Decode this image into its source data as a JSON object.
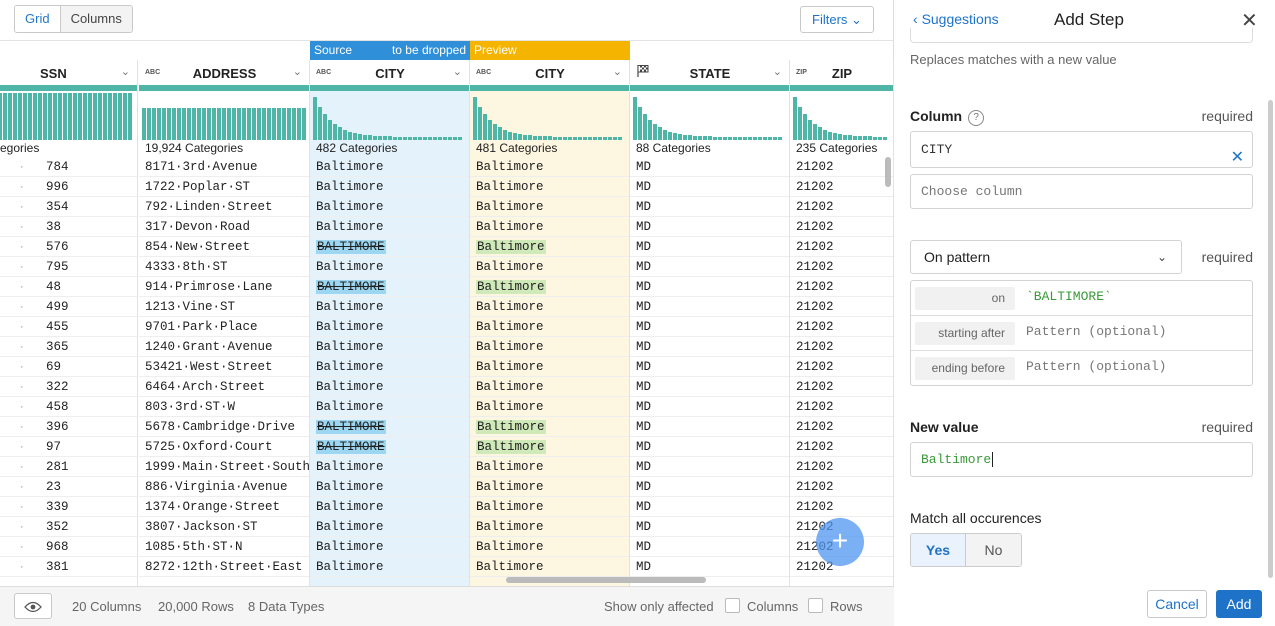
{
  "toolbar": {
    "tabs": [
      "Grid",
      "Columns"
    ],
    "filters_label": "Filters"
  },
  "grid": {
    "row_prefixes": [
      "784",
      "996",
      "354",
      "38",
      "576",
      "795",
      "48",
      "499",
      "455",
      "365",
      "69",
      "322",
      "458",
      "396",
      "97",
      "281",
      "23",
      "339",
      "352",
      "968",
      "381"
    ],
    "columns": [
      {
        "type": "",
        "name": "SSN",
        "categories": "egories",
        "values": []
      },
      {
        "type": "ABC",
        "name": "ADDRESS",
        "categories": "19,924 Categories",
        "values": [
          "8171·3rd·Avenue",
          "1722·Poplar·ST",
          "792·Linden·Street",
          "317·Devon·Road",
          "854·New·Street",
          "4333·8th·ST",
          "914·Primrose·Lane",
          "1213·Vine·ST",
          "9701·Park·Place",
          "1240·Grant·Avenue",
          "53421·West·Street",
          "6464·Arch·Street",
          "803·3rd·ST·W",
          "5678·Cambridge·Drive",
          "5725·Oxford·Court",
          "1999·Main·Street·South",
          "886·Virginia·Avenue",
          "1374·Orange·Street",
          "3807·Jackson·ST",
          "1085·5th·ST·N",
          "8272·12th·Street·East"
        ]
      },
      {
        "type": "ABC",
        "name": "CITY",
        "categories": "482 Categories",
        "tag": "Source",
        "tag_right": "to be dropped",
        "values": [
          "Baltimore",
          "Baltimore",
          "Baltimore",
          "Baltimore",
          "BALTIMORE",
          "Baltimore",
          "BALTIMORE",
          "Baltimore",
          "Baltimore",
          "Baltimore",
          "Baltimore",
          "Baltimore",
          "Baltimore",
          "BALTIMORE",
          "BALTIMORE",
          "Baltimore",
          "Baltimore",
          "Baltimore",
          "Baltimore",
          "Baltimore",
          "Baltimore"
        ]
      },
      {
        "type": "ABC",
        "name": "CITY",
        "categories": "481 Categories",
        "tag": "Preview",
        "values": [
          "Baltimore",
          "Baltimore",
          "Baltimore",
          "Baltimore",
          "Baltimore",
          "Baltimore",
          "Baltimore",
          "Baltimore",
          "Baltimore",
          "Baltimore",
          "Baltimore",
          "Baltimore",
          "Baltimore",
          "Baltimore",
          "Baltimore",
          "Baltimore",
          "Baltimore",
          "Baltimore",
          "Baltimore",
          "Baltimore",
          "Baltimore"
        ]
      },
      {
        "type": "flag",
        "name": "STATE",
        "categories": "88 Categories",
        "values": [
          "MD",
          "MD",
          "MD",
          "MD",
          "MD",
          "MD",
          "MD",
          "MD",
          "MD",
          "MD",
          "MD",
          "MD",
          "MD",
          "MD",
          "MD",
          "MD",
          "MD",
          "MD",
          "MD",
          "MD",
          "MD"
        ]
      },
      {
        "type": "ZIP",
        "name": "ZIP",
        "categories": "235 Categories",
        "values": [
          "21202",
          "21202",
          "21202",
          "21202",
          "21202",
          "21202",
          "21202",
          "21202",
          "21202",
          "21202",
          "21202",
          "21202",
          "21202",
          "21202",
          "21202",
          "21202",
          "21202",
          "21202",
          "21202",
          "21202",
          "21202"
        ]
      }
    ],
    "changed_rows": [
      4,
      6,
      13,
      14
    ]
  },
  "status": {
    "columns": "20 Columns",
    "rows": "20,000 Rows",
    "types": "8 Data Types",
    "show_only_affected": "Show only affected",
    "cb_columns": "Columns",
    "cb_rows": "Rows"
  },
  "panel": {
    "back": "Suggestions",
    "title": "Add Step",
    "description": "Replaces matches with a new value",
    "column_label": "Column",
    "required": "required",
    "column_value": "CITY",
    "choose_placeholder": "Choose column",
    "mode": "On pattern",
    "pattern_rows": [
      {
        "label": "on",
        "value": "`BALTIMORE`"
      },
      {
        "label": "starting after",
        "value": "Pattern (optional)"
      },
      {
        "label": "ending before",
        "value": "Pattern (optional)"
      }
    ],
    "new_value_label": "New value",
    "new_value": "Baltimore",
    "match_all_label": "Match all occurences",
    "yes": "Yes",
    "no": "No",
    "cancel": "Cancel",
    "add": "Add"
  },
  "colors": {
    "accent": "#1e73c8",
    "source_tag": "#2f8fd8",
    "preview_tag": "#f5b400",
    "source_col": "#e4f2fb",
    "preview_col": "#fdf6e0",
    "hist": "#4fb5a7"
  }
}
